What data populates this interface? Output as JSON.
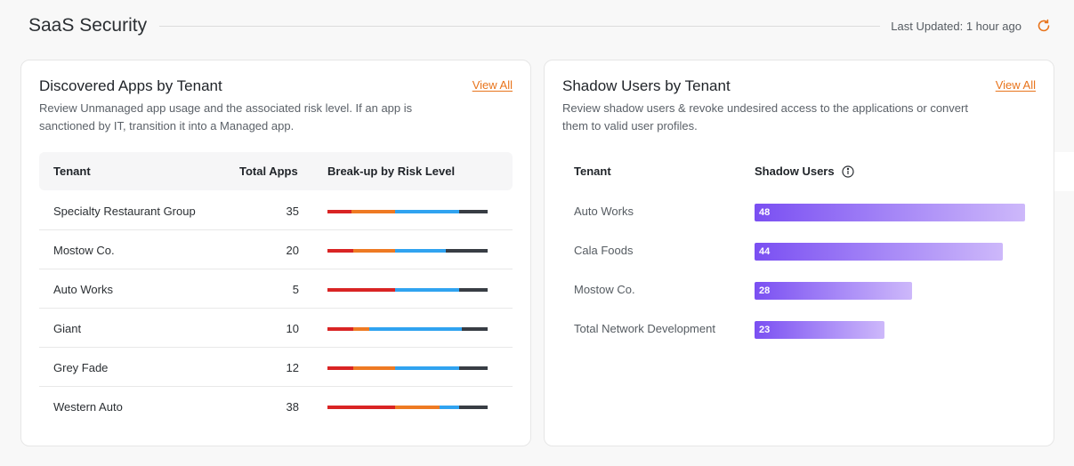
{
  "header": {
    "title": "SaaS Security",
    "last_updated": "Last Updated: 1 hour ago"
  },
  "risk_colors": [
    "#d92424",
    "#ee7a23",
    "#30a3f0",
    "#383d44"
  ],
  "discovered": {
    "title": "Discovered Apps by Tenant",
    "view_all": "View All",
    "description": "Review Unmanaged app usage and the associated risk level. If an app is sanctioned by IT, transition it into a Managed app.",
    "columns": [
      "Tenant",
      "Total Apps",
      "Break-up by Risk Level"
    ],
    "rows": [
      {
        "tenant": "Specialty Restaurant Group",
        "total": "35",
        "risk": [
          15,
          27,
          40,
          18
        ]
      },
      {
        "tenant": "Mostow Co.",
        "total": "20",
        "risk": [
          16,
          26,
          32,
          26
        ]
      },
      {
        "tenant": "Auto Works",
        "total": "5",
        "risk": [
          42,
          0,
          40,
          18
        ]
      },
      {
        "tenant": "Giant",
        "total": "10",
        "risk": [
          16,
          10,
          58,
          16
        ]
      },
      {
        "tenant": "Grey Fade",
        "total": "12",
        "risk": [
          16,
          26,
          40,
          18
        ]
      },
      {
        "tenant": "Western Auto",
        "total": "38",
        "risk": [
          42,
          28,
          12,
          18
        ]
      }
    ]
  },
  "shadow": {
    "title": "Shadow Users by Tenant",
    "view_all": "View All",
    "description": "Review shadow users & revoke undesired access to the applications or convert them to valid user profiles.",
    "columns": [
      "Tenant",
      "Shadow Users"
    ],
    "max": 48,
    "rows": [
      {
        "tenant": "Auto Works",
        "count": 48
      },
      {
        "tenant": "Cala Foods",
        "count": 44
      },
      {
        "tenant": "Mostow Co.",
        "count": 28
      },
      {
        "tenant": "Total Network Development",
        "count": 23
      }
    ]
  }
}
